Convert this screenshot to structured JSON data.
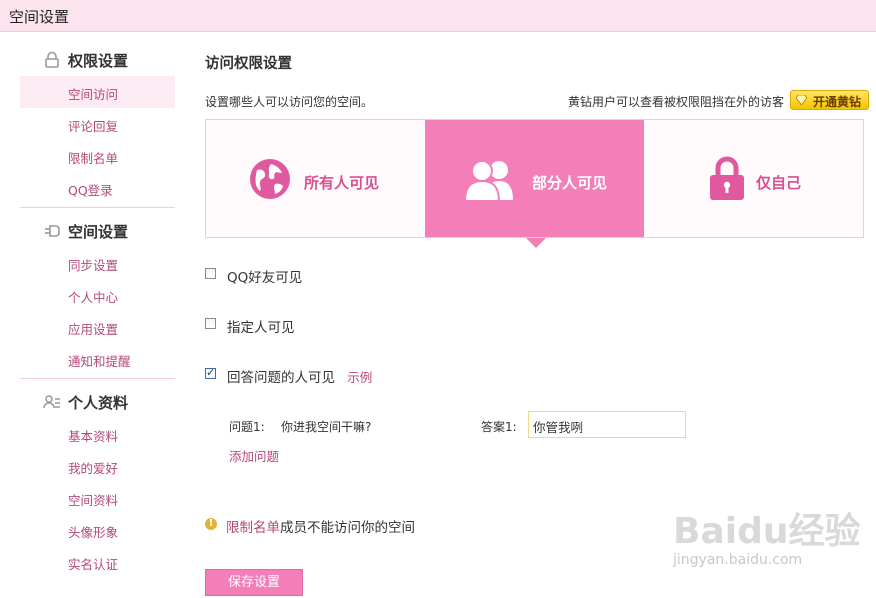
{
  "window": {
    "title": "空间设置"
  },
  "sidebar": {
    "sections": [
      {
        "title": "权限设置",
        "icon": "lock-icon",
        "items": [
          "空间访问",
          "评论回复",
          "限制名单",
          "QQ登录"
        ]
      },
      {
        "title": "空间设置",
        "icon": "plug-icon",
        "items": [
          "同步设置",
          "个人中心",
          "应用设置",
          "通知和提醒"
        ]
      },
      {
        "title": "个人资料",
        "icon": "profile-card-icon",
        "items": [
          "基本资料",
          "我的爱好",
          "空间资料",
          "头像形象",
          "实名认证"
        ]
      }
    ],
    "active_item": "空间访问"
  },
  "main": {
    "title": "访问权限设置",
    "description": "设置哪些人可以访问您的空间。",
    "yellow_note": "黄钻用户可以查看被权限阻挡在外的访客",
    "yellow_button": "开通黄钻",
    "options": [
      {
        "label": "所有人可见",
        "icon": "globe-icon",
        "selected": false
      },
      {
        "label": "部分人可见",
        "icon": "people-icon",
        "selected": true
      },
      {
        "label": "仅自己",
        "icon": "padlock-icon",
        "selected": false
      }
    ],
    "checkboxes": [
      {
        "label": "QQ好友可见",
        "checked": false
      },
      {
        "label": "指定人可见",
        "checked": false
      },
      {
        "label": "回答问题的人可见",
        "checked": true,
        "link": "示例"
      }
    ],
    "question": {
      "q_label": "问题1:",
      "q_text": "你进我空间干嘛?",
      "a_label": "答案1:",
      "a_value": "你管我咧"
    },
    "add_question": "添加问题",
    "warning": {
      "link": "限制名单",
      "text": "成员不能访问你的空间"
    },
    "save_button": "保存设置"
  },
  "watermark": {
    "logo": "Baidu经验",
    "sub": "jingyan.baidu.com"
  },
  "colors": {
    "accent": "#f37eb8",
    "link": "#b5487b",
    "title_bar": "#fce4ef",
    "gold": "#f6c400"
  }
}
